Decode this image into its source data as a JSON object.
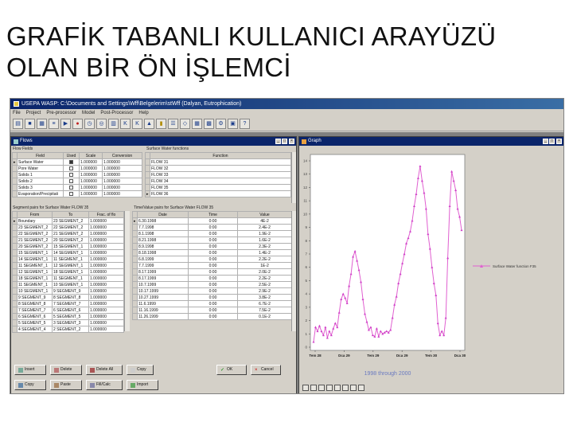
{
  "slide": {
    "title_line1": "GRAFİK TABANLI KULLANICI ARAYÜZÜ",
    "title_line2": "OLAN BİR ÖN İŞLEMCİ"
  },
  "app": {
    "title": "USEPA WASP: C:\\Documents and Settings\\Wff\\Belgelerim\\stWff (Dalyan, Eutrophication)",
    "menu": [
      "File",
      "Project",
      "Pre-processor",
      "Model",
      "Post-Processor",
      "Help"
    ],
    "toolbar_icons": [
      "open-icon",
      "save-icon",
      "print-icon",
      "data-icon",
      "run-icon",
      "stop-icon",
      "time-icon",
      "globe-icon",
      "chart-icon",
      "k-icon",
      "k2-icon",
      "plot-icon",
      "bar-icon",
      "list-icon",
      "map-icon",
      "table-icon",
      "grid-icon",
      "tool-icon",
      "calc-icon",
      "help-icon"
    ]
  },
  "flows": {
    "title": "Flows",
    "flow_fields_caption": "Flow Fields",
    "flow_headers": [
      "Field",
      "Used",
      "Scale",
      "Conversion"
    ],
    "flow_rows": [
      {
        "field": "Surface Water",
        "used": true,
        "scale": "1.000000",
        "conversion": "1.000000"
      },
      {
        "field": "Pore Water",
        "used": false,
        "scale": "1.000000",
        "conversion": "1.000000"
      },
      {
        "field": "Solids 1",
        "used": false,
        "scale": "1.000000",
        "conversion": "1.000000"
      },
      {
        "field": "Solids 2",
        "used": false,
        "scale": "1.000000",
        "conversion": "1.000000"
      },
      {
        "field": "Solids 3",
        "used": false,
        "scale": "1.000000",
        "conversion": "1.000000"
      },
      {
        "field": "Evaporation/Precipitati",
        "used": false,
        "scale": "1.000000",
        "conversion": "1.000000"
      }
    ],
    "functions_caption": "Surface Water functions",
    "function_header": "Function",
    "functions": [
      "FLOW 31",
      "FLOW 32",
      "FLOW 33",
      "FLOW 34",
      "FLOW 35",
      "FLOW 36"
    ],
    "segment_caption": "Segment pairs for Surface Water FLOW 35",
    "segment_headers": [
      "From",
      "To",
      "Frac. of flo"
    ],
    "segment_rows": [
      [
        "Boundary",
        "23 SEGMENT_2",
        "1.000000"
      ],
      [
        "23 SEGMENT_2",
        "22 SEGMENT_2",
        "1.000000"
      ],
      [
        "22 SEGMENT_2",
        "21 SEGMENT_2",
        "1.000000"
      ],
      [
        "21 SEGMENT_2",
        "20 SEGMENT_2",
        "1.000000"
      ],
      [
        "20 SEGMENT_2",
        "15 SEGMENT_1",
        "1.000000"
      ],
      [
        "15 SEGMENT_1",
        "14 SEGMENT_1",
        "1.000000"
      ],
      [
        "14 SEGMENT_1",
        "11 SEGMENT_1",
        "1.000000"
      ],
      [
        "11 SEGMENT_1",
        "12 SEGMENT_1",
        "1.000000"
      ],
      [
        "12 SEGMENT_1",
        "18 SEGMENT_1",
        "1.000000"
      ],
      [
        "18 SEGMENT_1",
        "11 SEGMENT_1",
        "1.000000"
      ],
      [
        "11 SEGMENT_1",
        "10 SEGMENT_1",
        "1.000000"
      ],
      [
        "10 SEGMENT_1",
        "9 SEGMENT_9",
        "1.000000"
      ],
      [
        "9 SEGMENT_9",
        "8 SEGMENT_8",
        "1.000000"
      ],
      [
        "8 SEGMENT_8",
        "7 SEGMENT_7",
        "1.000000"
      ],
      [
        "7 SEGMENT_7",
        "6 SEGMENT_6",
        "1.000000"
      ],
      [
        "6 SEGMENT_6",
        "5 SEGMENT_5",
        "1.000000"
      ],
      [
        "5 SEGMENT_5",
        "3 SEGMENT_3",
        "1.000000"
      ],
      [
        "4 SEGMENT_4",
        "2 SEGMENT_2",
        "1.000000"
      ]
    ],
    "tv_caption": "Time/Value pairs for Surface Water FLOW 35",
    "tv_headers": [
      "Date",
      "Time",
      "Value"
    ],
    "tv_rows": [
      [
        "6.30.1998",
        "0:00",
        "4E-2"
      ],
      [
        "7.7.1998",
        "0:00",
        "2.4E-2"
      ],
      [
        "8.1.1998",
        "0:00",
        "1.9E-2"
      ],
      [
        "8.21.1998",
        "0:00",
        "1.6E-2"
      ],
      [
        "8.9.1998",
        "0:00",
        "2.3E-2"
      ],
      [
        "8.18.1998",
        "0:00",
        "1.4E-2"
      ],
      [
        "6.8.1999",
        "0:00",
        "2.2E-2"
      ],
      [
        "7.7.1999",
        "0:00",
        "1E-2"
      ],
      [
        "8.17.1999",
        "0:00",
        "2.0E-2"
      ],
      [
        "8.17.1999",
        "0:00",
        "2.2E-2"
      ],
      [
        "10.7.1999",
        "0:00",
        "2.5E-2"
      ],
      [
        "10.17.1999",
        "0:00",
        "2.9E-2"
      ],
      [
        "10.27.1999",
        "0:00",
        "3.8E-2"
      ],
      [
        "11.6.1999",
        "0:00",
        "6.7E-2"
      ],
      [
        "11.16.1999",
        "0:00",
        "7.5E-2"
      ],
      [
        "11.26.1999",
        "0:00",
        "0.1E-2"
      ]
    ],
    "buttons_row1": [
      "Insert",
      "Delete",
      "Delete All",
      "Copy",
      "OK",
      "Cancel"
    ],
    "buttons_row2": [
      "Copy",
      "Paste",
      "Fill/Calc",
      "Import"
    ]
  },
  "graph": {
    "title": "Graph",
    "legend": "Surface Water function F35",
    "x_ticks": [
      "Tem 28",
      "Dca 29",
      "Tem 29",
      "Dca 29",
      "Tem 30",
      "Dca 30"
    ],
    "subtitle": "1998 through 2000"
  },
  "chart_data": {
    "type": "line",
    "x": [
      0,
      1,
      2,
      3,
      4,
      5,
      6,
      7,
      8,
      9,
      10,
      11,
      12,
      13,
      14,
      15,
      16,
      17,
      18,
      19,
      20,
      21,
      22,
      23,
      24,
      25,
      26,
      27,
      28,
      29,
      30,
      31,
      32,
      33,
      34,
      35,
      36,
      37,
      38,
      39,
      40,
      41,
      42,
      43,
      44,
      45,
      46,
      47,
      48,
      49,
      50,
      51,
      52,
      53,
      54,
      55,
      56,
      57,
      58,
      59,
      60,
      61,
      62,
      63,
      64,
      65,
      66,
      67,
      68,
      69,
      70,
      71,
      72,
      73,
      74,
      75
    ],
    "series": [
      {
        "name": "Surface Water function F35",
        "values": [
          0.4,
          1.5,
          1.2,
          1.6,
          1.2,
          0.9,
          1.5,
          0.7,
          1.2,
          0.9,
          1.4,
          1.8,
          1.5,
          2.6,
          3.6,
          4.0,
          3.7,
          3.3,
          4.6,
          5.5,
          6.8,
          7.2,
          6.5,
          5.8,
          4.9,
          3.6,
          2.5,
          1.9,
          1.3,
          1.5,
          0.9,
          0.8,
          1.4,
          0.8,
          1.2,
          1.0,
          1.1,
          1.2,
          1.1,
          1.3,
          2.2,
          3.2,
          3.8,
          4.8,
          5.5,
          6.3,
          7.0,
          7.8,
          8.2,
          8.7,
          9.5,
          10.6,
          11.5,
          12.7,
          13.6,
          12.5,
          11.6,
          10.4,
          8.5,
          7.4,
          6.0,
          4.8,
          3.9,
          1.8,
          0.9,
          1.2,
          0.9,
          2.2,
          6.7,
          10.6,
          13.2,
          12.5,
          11.8,
          10.4,
          9.8,
          8.8
        ]
      }
    ],
    "xlabel": "1998 through 2000",
    "ylabel": "",
    "ylim": [
      0,
      14
    ],
    "y_ticks": [
      0,
      1,
      2,
      3,
      4,
      5,
      6,
      7,
      8,
      9,
      10,
      11,
      12,
      13,
      14
    ],
    "grid": false,
    "legend": "right"
  }
}
